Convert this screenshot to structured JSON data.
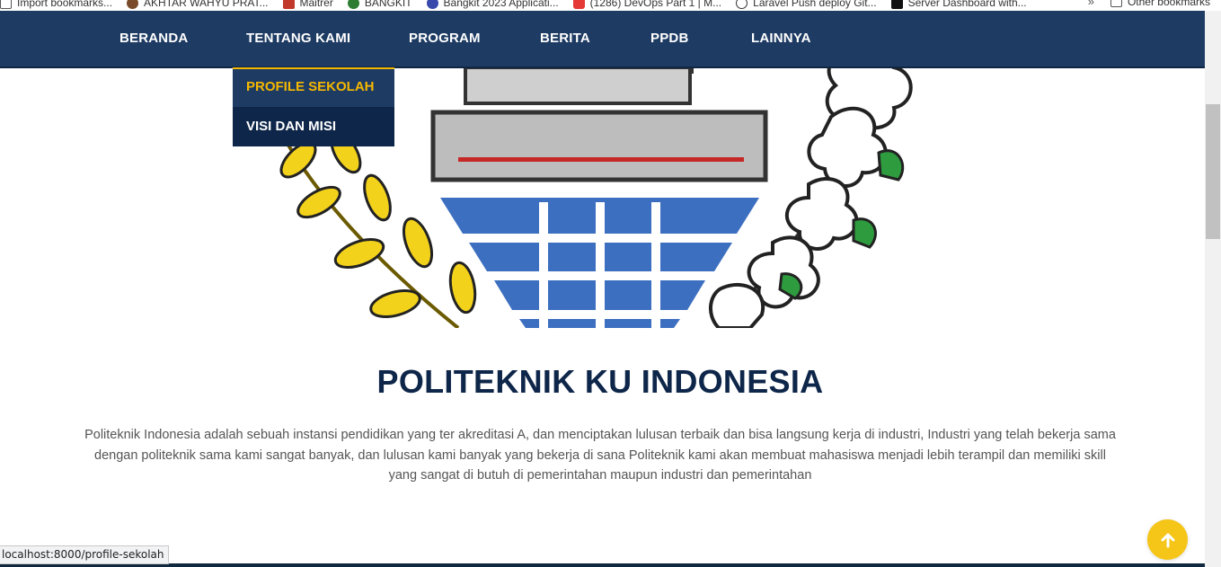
{
  "bookmarks": {
    "items": [
      {
        "label": "Import bookmarks...",
        "icon": "folder-icon",
        "color": "#555555"
      },
      {
        "label": "AKHTAR WAHYU PRAT...",
        "icon": "site-icon",
        "color": "#7a4b2a"
      },
      {
        "label": "Maitrer",
        "icon": "page-icon",
        "color": "#c0392b"
      },
      {
        "label": "BANGKIT",
        "icon": "leaf-icon",
        "color": "#2e7d32"
      },
      {
        "label": "Bangkit 2023 Applicati...",
        "icon": "app-icon",
        "color": "#3949ab"
      },
      {
        "label": "(1286) DevOps Part 1 | M...",
        "icon": "youtube-icon",
        "color": "#e53935"
      },
      {
        "label": "Laravel Push deploy Git...",
        "icon": "git-icon",
        "color": "#333333"
      },
      {
        "label": "Server Dashboard with...",
        "icon": "terminal-icon",
        "color": "#111111"
      }
    ],
    "more": "»",
    "other": "Other bookmarks"
  },
  "nav": {
    "items": [
      "BERANDA",
      "TENTANG KAMI",
      "PROGRAM",
      "BERITA",
      "PPDB",
      "LAINNYA"
    ],
    "bg": "#1e3b63"
  },
  "dropdown": {
    "items": [
      "PROFILE SEKOLAH",
      "VISI DAN MISI"
    ],
    "active_color": "#f5b800"
  },
  "hero": {
    "icon": "school-emblem-logo"
  },
  "content": {
    "title": "POLITEKNIK KU INDONESIA",
    "description": "Politeknik Indonesia adalah sebuah instansi pendidikan yang ter akreditasi A, dan menciptakan lulusan terbaik dan bisa langsung kerja di industri, Industri yang telah bekerja sama dengan politeknik sama kami sangat banyak, dan lulusan kami banyak yang bekerja di sana Politeknik kami akan membuat mahasiswa menjadi lebih terampil dan memiliki skill yang sangat di butuh di pemerintahan maupun industri dan pemerintahan"
  },
  "back_to_top": {
    "icon": "arrow-up-icon",
    "color": "#f5c518"
  },
  "status_url": "localhost:8000/profile-sekolah"
}
